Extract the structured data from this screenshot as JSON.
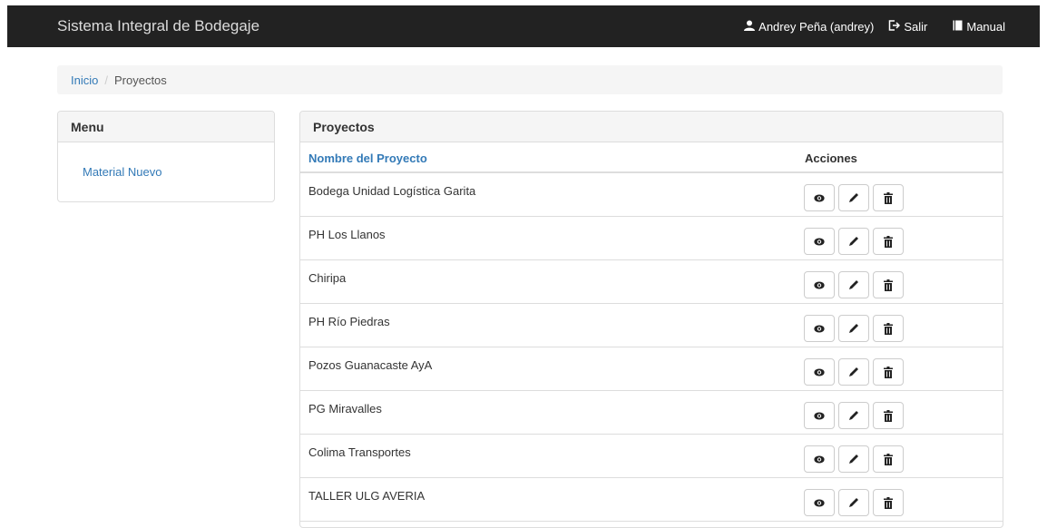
{
  "navbar": {
    "brand": "Sistema Integral de Bodegaje",
    "user": "Andrey Peña (andrey)",
    "logout": "Salir",
    "manual": "Manual",
    "icons": [
      "user-icon",
      "logout-icon",
      "book-icon"
    ]
  },
  "breadcrumb": {
    "home": "Inicio",
    "separator": "/",
    "current": "Proyectos"
  },
  "menu": {
    "title": "Menu",
    "items": [
      {
        "label": "Material Nuevo"
      }
    ]
  },
  "projects": {
    "title": "Proyectos",
    "columns": {
      "name": "Nombre del Proyecto",
      "actions": "Acciones"
    },
    "action_icons": [
      "eye-icon",
      "pencil-icon",
      "trash-icon"
    ],
    "rows": [
      {
        "name": "Bodega Unidad Logística Garita"
      },
      {
        "name": "PH Los Llanos"
      },
      {
        "name": "Chiripa"
      },
      {
        "name": "PH Río Piedras"
      },
      {
        "name": "Pozos Guanacaste AyA"
      },
      {
        "name": "PG Miravalles"
      },
      {
        "name": "Colima Transportes"
      },
      {
        "name": "TALLER ULG AVERIA"
      }
    ]
  },
  "colors": {
    "navbar": "#222222",
    "link": "#337ab7",
    "panel_heading": "#f5f5f5"
  }
}
